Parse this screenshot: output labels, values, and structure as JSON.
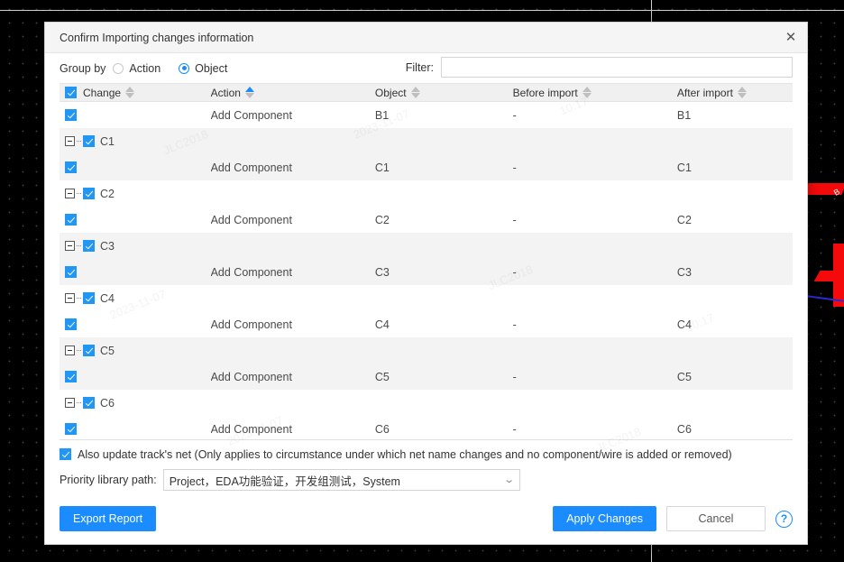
{
  "dialog": {
    "title": "Confirm Importing changes information",
    "close_icon": "close-icon"
  },
  "groupby": {
    "label": "Group by",
    "options": [
      {
        "label": "Action",
        "selected": false
      },
      {
        "label": "Object",
        "selected": true
      }
    ]
  },
  "filter": {
    "label": "Filter:",
    "value": "",
    "placeholder": ""
  },
  "table": {
    "columns": [
      {
        "key": "change",
        "label": "Change",
        "sort": "none",
        "has_checkbox": true,
        "checked": true
      },
      {
        "key": "action",
        "label": "Action",
        "sort": "asc"
      },
      {
        "key": "object",
        "label": "Object",
        "sort": "none"
      },
      {
        "key": "before",
        "label": "Before import",
        "sort": "none"
      },
      {
        "key": "after",
        "label": "After import",
        "sort": "none"
      }
    ],
    "rows": [
      {
        "type": "child",
        "checked": true,
        "shade": false,
        "action": "Add Component",
        "object": "B1",
        "before": "-",
        "after": "B1"
      },
      {
        "type": "group",
        "checked": true,
        "shade": true,
        "label": "C1",
        "action": "",
        "object": "",
        "before": "",
        "after": ""
      },
      {
        "type": "child",
        "checked": true,
        "shade": true,
        "action": "Add Component",
        "object": "C1",
        "before": "-",
        "after": "C1"
      },
      {
        "type": "group",
        "checked": true,
        "shade": false,
        "label": "C2",
        "action": "",
        "object": "",
        "before": "",
        "after": ""
      },
      {
        "type": "child",
        "checked": true,
        "shade": false,
        "action": "Add Component",
        "object": "C2",
        "before": "-",
        "after": "C2"
      },
      {
        "type": "group",
        "checked": true,
        "shade": true,
        "label": "C3",
        "action": "",
        "object": "",
        "before": "",
        "after": ""
      },
      {
        "type": "child",
        "checked": true,
        "shade": true,
        "action": "Add Component",
        "object": "C3",
        "before": "-",
        "after": "C3"
      },
      {
        "type": "group",
        "checked": true,
        "shade": false,
        "label": "C4",
        "action": "",
        "object": "",
        "before": "",
        "after": ""
      },
      {
        "type": "child",
        "checked": true,
        "shade": false,
        "action": "Add Component",
        "object": "C4",
        "before": "-",
        "after": "C4"
      },
      {
        "type": "group",
        "checked": true,
        "shade": true,
        "label": "C5",
        "action": "",
        "object": "",
        "before": "",
        "after": ""
      },
      {
        "type": "child",
        "checked": true,
        "shade": true,
        "action": "Add Component",
        "object": "C5",
        "before": "-",
        "after": "C5"
      },
      {
        "type": "group",
        "checked": true,
        "shade": false,
        "label": "C6",
        "action": "",
        "object": "",
        "before": "",
        "after": ""
      },
      {
        "type": "child",
        "checked": true,
        "shade": false,
        "action": "Add Component",
        "object": "C6",
        "before": "-",
        "after": "C6"
      }
    ]
  },
  "options": {
    "update_track_net": {
      "checked": true,
      "label": "Also update track's net (Only applies to circumstance under which net name changes and no component/wire is added or removed)"
    },
    "priority_library": {
      "label": "Priority library path:",
      "value": "Project，EDA功能验证，开发组测试，System"
    }
  },
  "buttons": {
    "export_report": "Export Report",
    "apply_changes": "Apply Changes",
    "cancel": "Cancel",
    "help_icon": "?"
  },
  "watermark": {
    "line1": "JLC2018",
    "line2": "2023-11-07",
    "line3": "10:17"
  },
  "colors": {
    "accent": "#1a8cff",
    "checkbox": "#2196f3",
    "header_bg": "#f0f0f0",
    "row_shade": "#f3f3f3",
    "pcb_trace_red": "#f40a0a",
    "pcb_trace_blue": "#2a2ad8"
  },
  "pcb_background": {
    "pad_label": "B"
  }
}
